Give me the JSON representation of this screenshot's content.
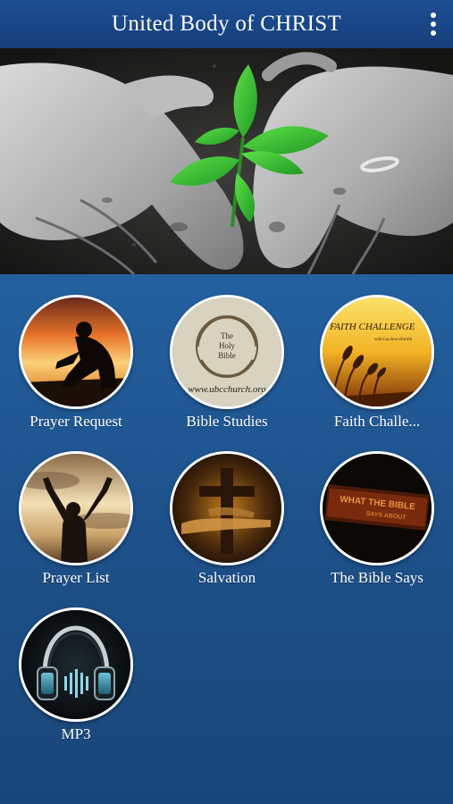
{
  "appbar": {
    "title": "United Body of CHRIST",
    "menu_icon": "more-vert-icon"
  },
  "hero": {
    "image": "hands-heart-seedling"
  },
  "tiles": [
    {
      "label": "Prayer Request",
      "image": "kneeling-silhouette-sunset"
    },
    {
      "label": "Bible Studies",
      "image": "holy-bible-seal",
      "image_text": "The Holy Bible",
      "caption_text": "www.ubcchurch.org"
    },
    {
      "label": "Faith Challe...",
      "image": "wheat-sunset",
      "image_text": "FAITH CHALLENGE",
      "subtext": "with Lucdeva Hardin"
    },
    {
      "label": "Prayer List",
      "image": "raised-arms-sky"
    },
    {
      "label": "Salvation",
      "image": "cross-hands"
    },
    {
      "label": "The Bible Says",
      "image": "bible-says-banner",
      "image_text": "WHAT THE BIBLE",
      "subtext": "SAYS ABOUT"
    },
    {
      "label": "MP3",
      "image": "headphones-icon"
    }
  ]
}
